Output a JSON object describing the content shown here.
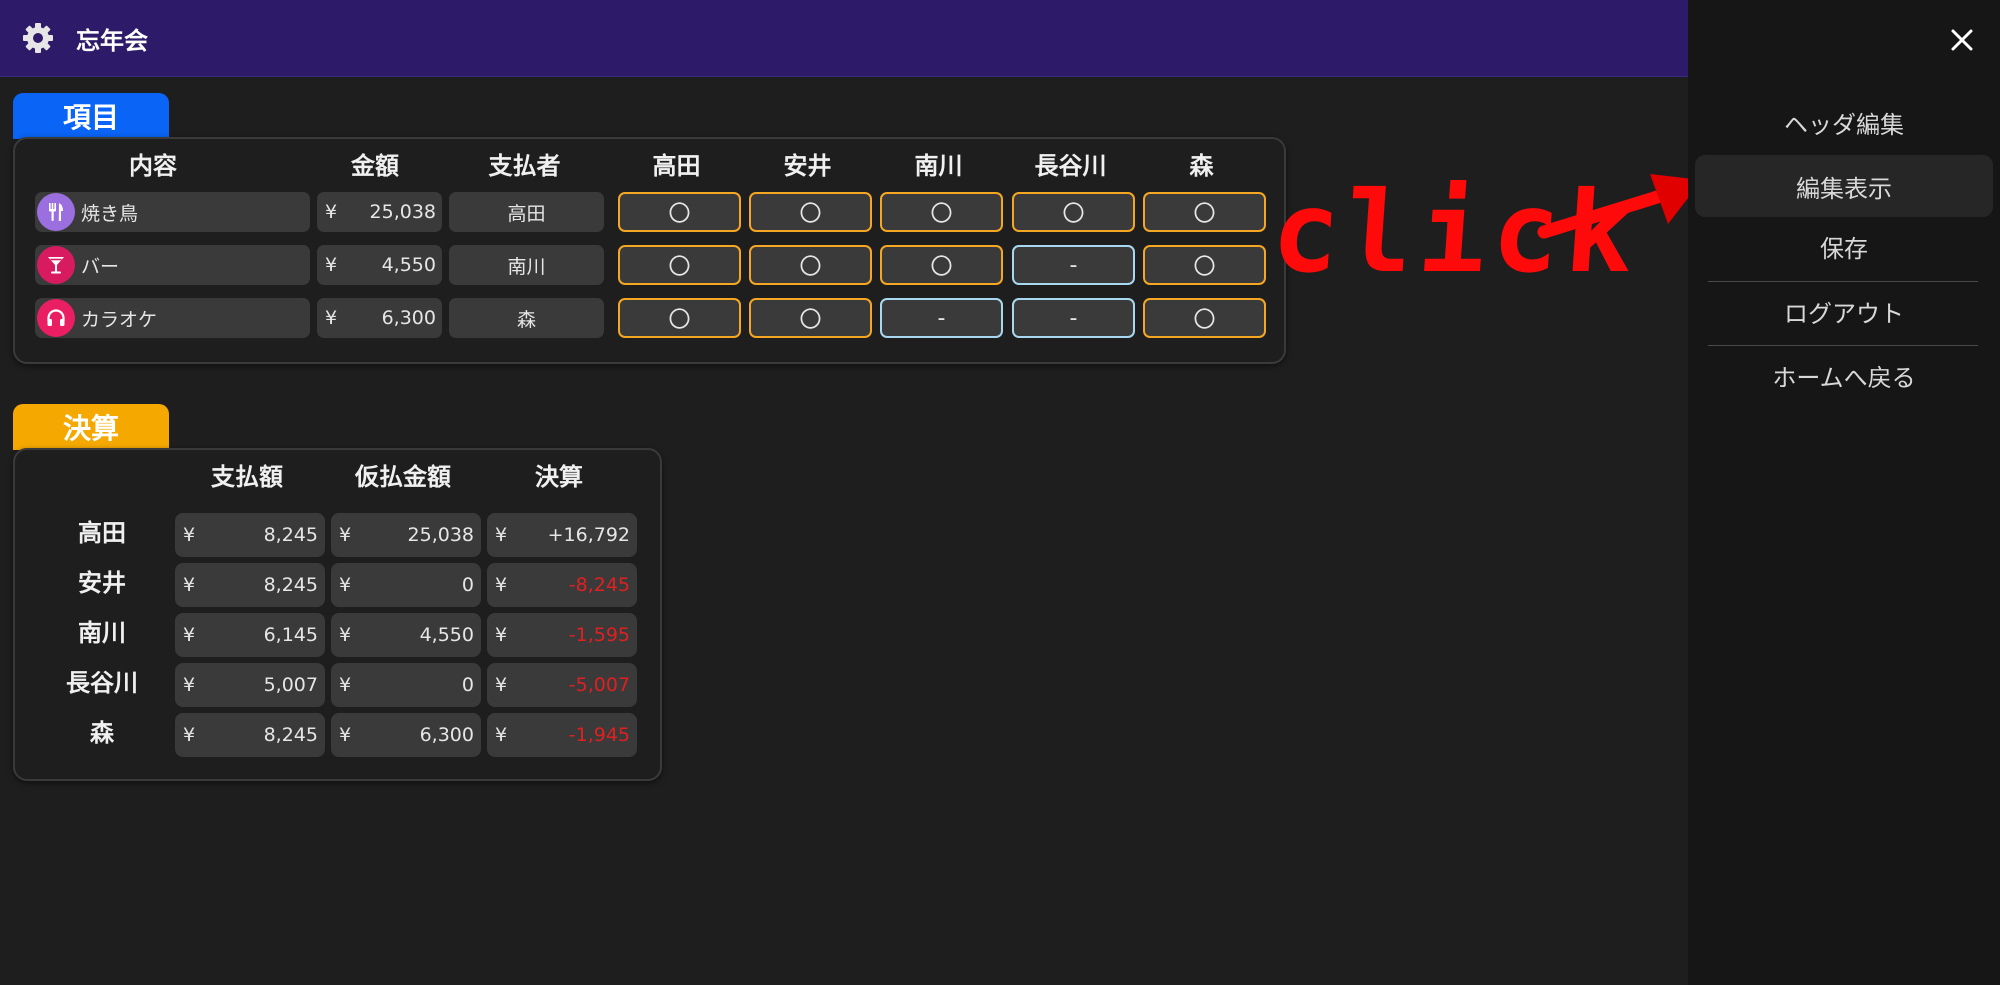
{
  "header": {
    "title": "忘年会",
    "settings_icon": "gear-icon"
  },
  "items_section": {
    "tab_label": "項目",
    "columns": [
      "内容",
      "金額",
      "支払者",
      "高田",
      "安井",
      "南川",
      "長谷川",
      "森"
    ],
    "rows": [
      {
        "name": "焼き鳥",
        "icon": "utensils-icon",
        "icon_color": "#9c6fe0",
        "currency": "¥",
        "amount": "25,038",
        "payer": "高田",
        "shares": [
          "〇",
          "〇",
          "〇",
          "〇",
          "〇"
        ],
        "share_on": [
          true,
          true,
          true,
          true,
          true
        ]
      },
      {
        "name": "バー",
        "icon": "cocktail-icon",
        "icon_color": "#d81b60",
        "currency": "¥",
        "amount": "4,550",
        "payer": "南川",
        "shares": [
          "〇",
          "〇",
          "〇",
          "-",
          "〇"
        ],
        "share_on": [
          true,
          true,
          true,
          false,
          true
        ]
      },
      {
        "name": "カラオケ",
        "icon": "headphones-icon",
        "icon_color": "#e91e63",
        "currency": "¥",
        "amount": "6,300",
        "payer": "森",
        "shares": [
          "〇",
          "〇",
          "-",
          "-",
          "〇"
        ],
        "share_on": [
          true,
          true,
          false,
          false,
          true
        ]
      }
    ]
  },
  "settle_section": {
    "tab_label": "決算",
    "columns": [
      "支払額",
      "仮払金額",
      "決算"
    ],
    "rows": [
      {
        "name": "高田",
        "currency": "¥",
        "pay": "8,245",
        "advance": "25,038",
        "settle": "+16,792",
        "negative": false
      },
      {
        "name": "安井",
        "currency": "¥",
        "pay": "8,245",
        "advance": "0",
        "settle": "-8,245",
        "negative": true
      },
      {
        "name": "南川",
        "currency": "¥",
        "pay": "6,145",
        "advance": "4,550",
        "settle": "-1,595",
        "negative": true
      },
      {
        "name": "長谷川",
        "currency": "¥",
        "pay": "5,007",
        "advance": "0",
        "settle": "-5,007",
        "negative": true
      },
      {
        "name": "森",
        "currency": "¥",
        "pay": "8,245",
        "advance": "6,300",
        "settle": "-1,945",
        "negative": true
      }
    ]
  },
  "annotation": {
    "text": "click",
    "color": "#ff0a0a"
  },
  "sidebar": {
    "close_icon": "close-icon",
    "items": [
      {
        "label": "ヘッダ編集",
        "active": false
      },
      {
        "label": "編集表示",
        "active": true
      },
      {
        "label": "保存",
        "active": false
      },
      {
        "label": "ログアウト",
        "active": false
      },
      {
        "label": "ホームへ戻る",
        "active": false
      }
    ]
  },
  "colors": {
    "header_bg": "#2d1b69",
    "items_tab": "#0a64f5",
    "settle_tab": "#f5a800",
    "share_on_border": "#f5a623",
    "share_off_border": "#a8d8f0",
    "negative": "#e02020"
  }
}
